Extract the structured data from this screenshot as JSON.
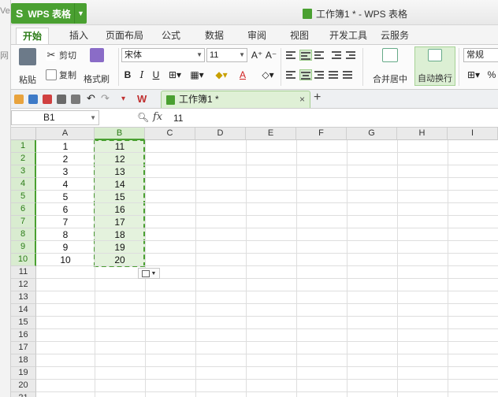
{
  "app": {
    "name": "WPS 表格",
    "logo": "S",
    "window_title": "工作簿1 * - WPS 表格",
    "left_window_fragments": [
      "Ve",
      "网"
    ]
  },
  "tabs": [
    "开始",
    "插入",
    "页面布局",
    "公式",
    "数据",
    "审阅",
    "视图",
    "开发工具",
    "云服务"
  ],
  "ribbon": {
    "paste": "粘贴",
    "cut": "剪切",
    "copy": "复制",
    "format_painter": "格式刷",
    "font_name": "宋体",
    "font_size": "11",
    "bold": "B",
    "italic": "I",
    "underline": "U",
    "font_color_letter": "A",
    "merge_center": "合并居中",
    "wrap_text": "自动换行",
    "number_format": "常规",
    "percent": "%"
  },
  "doc_tab": {
    "title": "工作簿1 *",
    "close": "×",
    "new_tab": "+"
  },
  "formula_bar": {
    "name_box": "B1",
    "fx": "fx",
    "value": "11"
  },
  "sheet": {
    "columns": [
      "A",
      "B",
      "C",
      "D",
      "E",
      "F",
      "G",
      "H",
      "I"
    ],
    "rows": [
      "1",
      "2",
      "3",
      "4",
      "5",
      "6",
      "7",
      "8",
      "9",
      "10",
      "11",
      "12",
      "13",
      "14",
      "15",
      "16",
      "17",
      "18",
      "19",
      "20",
      "21"
    ],
    "col_a": [
      "1",
      "2",
      "3",
      "4",
      "5",
      "6",
      "7",
      "8",
      "9",
      "10"
    ],
    "col_b": [
      "11",
      "12",
      "13",
      "14",
      "15",
      "16",
      "17",
      "18",
      "19",
      "20"
    ],
    "active_column": "B",
    "selected_rows": 10
  },
  "colors": {
    "accent": "#4aa031",
    "selection_fill": "#e4f2dd"
  }
}
